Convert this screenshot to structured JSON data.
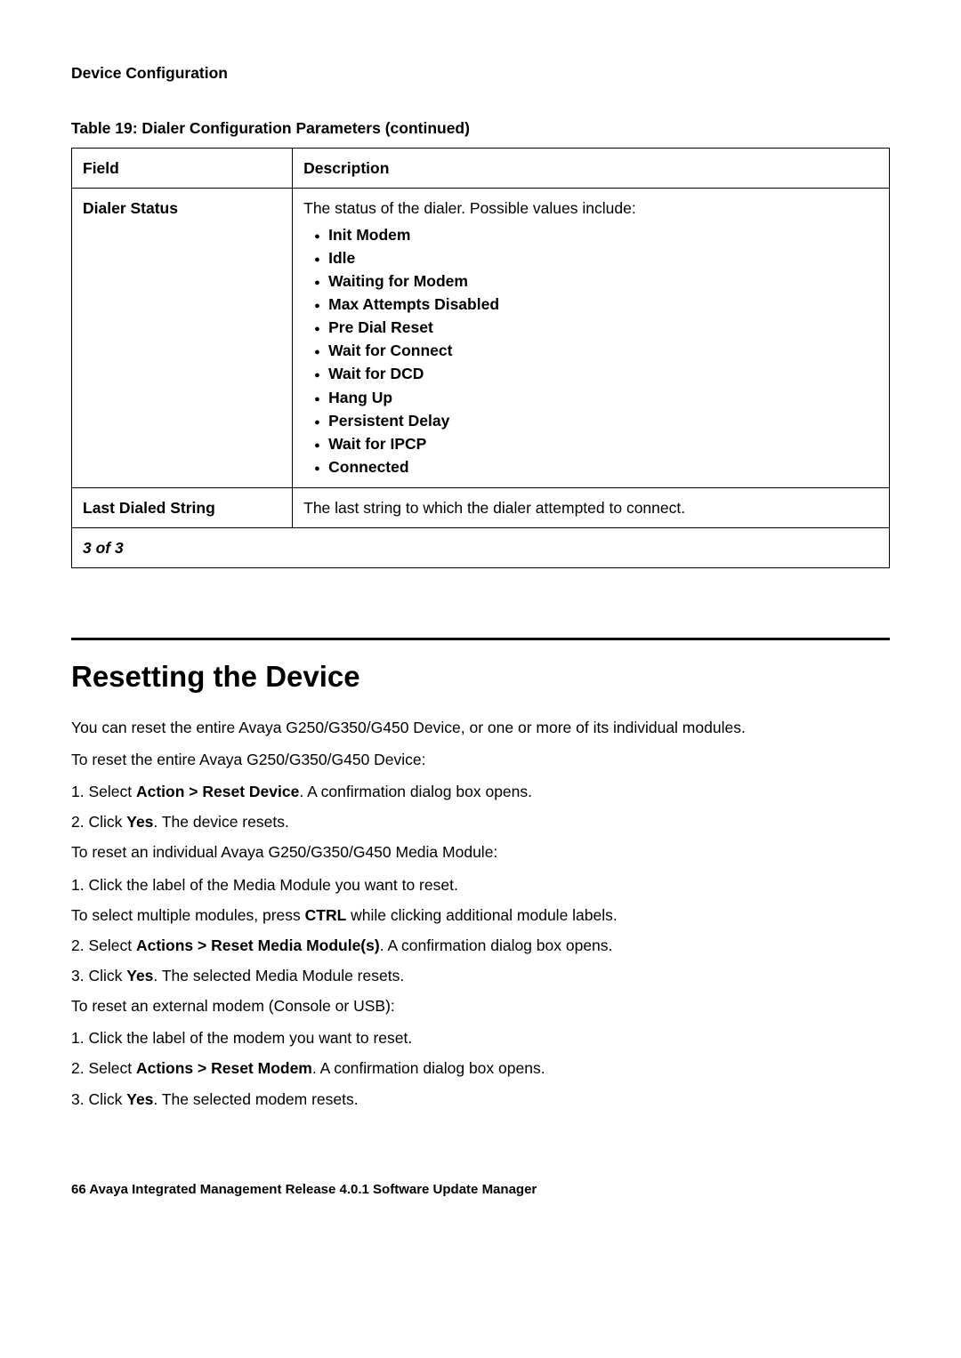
{
  "header": "Device Configuration",
  "table": {
    "caption": "Table 19: Dialer Configuration Parameters (continued)",
    "col_field": "Field",
    "col_desc": "Description",
    "row1_field": "Dialer Status",
    "row1_intro": "The status of the dialer. Possible values include:",
    "row1_items": [
      "Init Modem",
      "Idle",
      "Waiting for Modem",
      "Max Attempts Disabled",
      "Pre Dial Reset",
      "Wait for Connect",
      "Wait for DCD",
      "Hang Up",
      "Persistent Delay",
      "Wait for IPCP",
      "Connected"
    ],
    "row2_field": "Last Dialed String",
    "row2_desc": "The last string to which the dialer attempted to connect.",
    "pager": "3 of 3"
  },
  "title": "Resetting the Device",
  "p_intro": "You can reset the entire Avaya G250/G350/G450 Device, or one or more of its individual modules.",
  "p_reset_device": "To reset the entire Avaya G250/G350/G450 Device:",
  "device_step1_a": "1. Select ",
  "device_step1_b": "Action > Reset Device",
  "device_step1_c": ". A confirmation dialog box opens.",
  "device_step2_a": "2. Click ",
  "device_step2_b": "Yes",
  "device_step2_c": ". The device resets.",
  "p_reset_module": "To reset an individual Avaya G250/G350/G450 Media Module:",
  "module_step1": "1. Click the label of the Media Module you want to reset.",
  "module_sub_a": "To select multiple modules, press ",
  "module_sub_b": "CTRL",
  "module_sub_c": " while clicking additional module labels.",
  "module_step2_a": "2. Select ",
  "module_step2_b": "Actions > Reset Media Module(s)",
  "module_step2_c": ". A confirmation dialog box opens.",
  "module_step3_a": "3. Click ",
  "module_step3_b": "Yes",
  "module_step3_c": ". The selected Media Module resets.",
  "p_reset_modem": "To reset an external modem (Console or USB):",
  "modem_step1": "1. Click the label of the modem you want to reset.",
  "modem_step2_a": "2. Select ",
  "modem_step2_b": "Actions > Reset Modem",
  "modem_step2_c": ". A confirmation dialog box opens.",
  "modem_step3_a": "3. Click ",
  "modem_step3_b": "Yes",
  "modem_step3_c": ". The selected modem resets.",
  "footer": "66   Avaya Integrated Management Release 4.0.1 Software Update Manager"
}
